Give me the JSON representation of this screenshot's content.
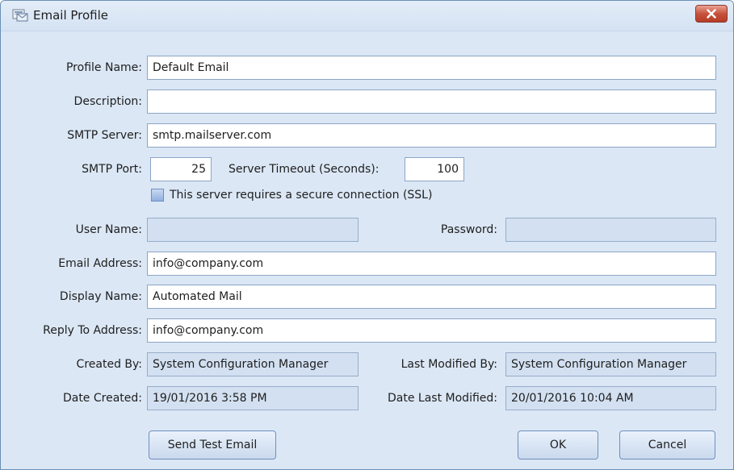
{
  "window": {
    "title": "Email Profile",
    "icon": "mail-profile-icon"
  },
  "labels": {
    "profile_name": "Profile Name:",
    "description": "Description:",
    "smtp_server": "SMTP Server:",
    "smtp_port": "SMTP Port:",
    "server_timeout": "Server Timeout (Seconds):",
    "ssl": "This server requires a secure connection (SSL)",
    "user_name": "User Name:",
    "password": "Password:",
    "email_address": "Email Address:",
    "display_name": "Display Name:",
    "reply_to": "Reply To Address:",
    "created_by": "Created By:",
    "last_modified_by": "Last Modified By:",
    "date_created": "Date Created:",
    "date_last_modified": "Date Last Modified:"
  },
  "values": {
    "profile_name": "Default Email",
    "description": "",
    "smtp_server": "smtp.mailserver.com",
    "smtp_port": "25",
    "server_timeout": "100",
    "ssl_checked": false,
    "user_name": "",
    "password": "",
    "email_address": "info@company.com",
    "display_name": "Automated Mail",
    "reply_to": "info@company.com",
    "created_by": "System Configuration Manager",
    "last_modified_by": "System Configuration Manager",
    "date_created": "19/01/2016 3:58 PM",
    "date_last_modified": "20/01/2016 10:04 AM"
  },
  "buttons": {
    "send_test": "Send Test Email",
    "ok": "OK",
    "cancel": "Cancel"
  },
  "colors": {
    "background": "#dbe7f5",
    "field_border": "#8da5c6",
    "close_button": "#c7523d"
  }
}
